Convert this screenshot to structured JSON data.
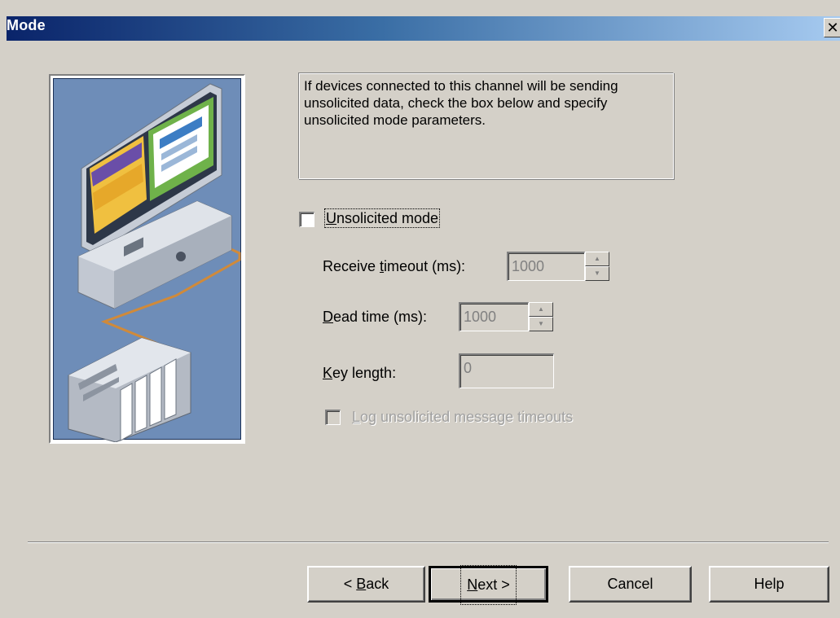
{
  "window": {
    "title": "Mode",
    "close_glyph": "✕"
  },
  "description": "If devices connected to this channel will be sending unsolicited data, check the box below and specify unsolicited mode parameters.",
  "unsolicited_mode": {
    "label_pre": "",
    "label_accel": "U",
    "label_post": "nsolicited mode",
    "checked": false
  },
  "receive_timeout": {
    "label_pre": "Receive ",
    "label_accel": "t",
    "label_post": "imeout (ms):",
    "value": "1000",
    "enabled": false
  },
  "dead_time": {
    "label_pre": "",
    "label_accel": "D",
    "label_post": "ead time (ms):",
    "value": "1000",
    "enabled": false
  },
  "key_length": {
    "label_pre": "",
    "label_accel": "K",
    "label_post": "ey length:",
    "value": "0",
    "enabled": false
  },
  "log_timeouts": {
    "label_pre": "",
    "label_accel": "L",
    "label_post": "og unsolicited message timeouts",
    "checked": false,
    "enabled": false
  },
  "buttons": {
    "back": {
      "pre": "< ",
      "accel": "B",
      "post": "ack"
    },
    "next": {
      "pre": "",
      "accel": "N",
      "post": "ext >"
    },
    "cancel": {
      "label": "Cancel"
    },
    "help": {
      "label": "Help"
    }
  },
  "icons": {
    "illustration": "computer-and-plc-network-illustration",
    "spin_up": "spin-up-arrow-icon",
    "spin_down": "spin-down-arrow-icon"
  }
}
